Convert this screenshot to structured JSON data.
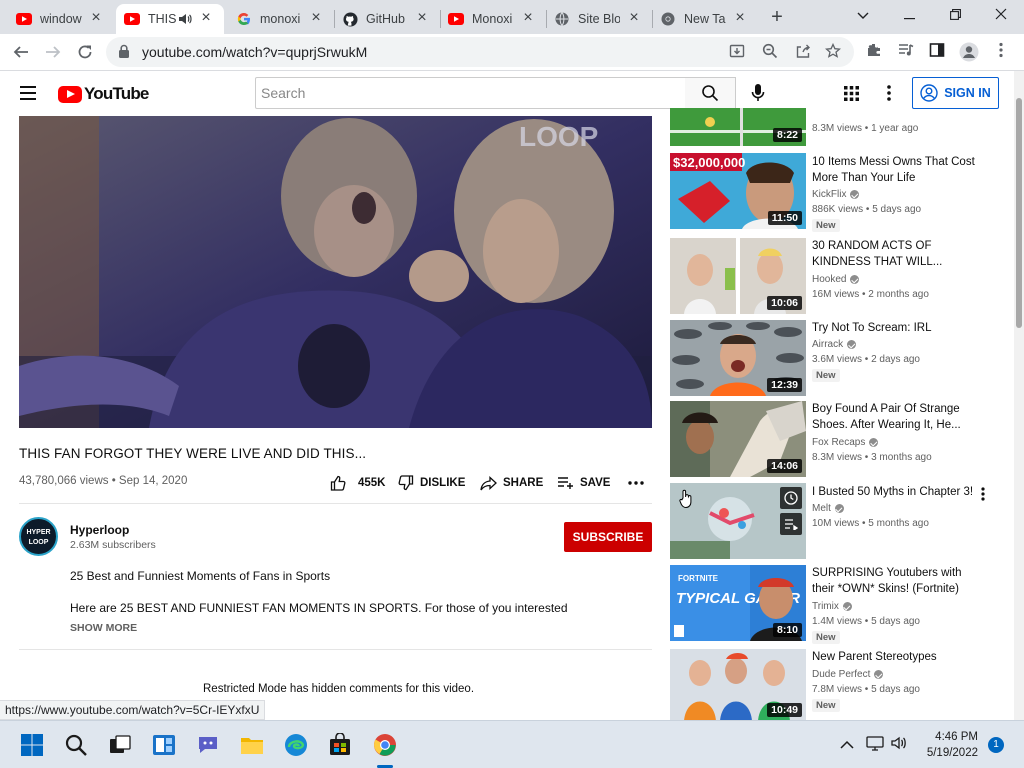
{
  "browser": {
    "tabs": [
      {
        "title": "window",
        "icon": "youtube-favicon"
      },
      {
        "title": "THIS",
        "icon": "youtube-favicon",
        "audio": true
      },
      {
        "title": "monoxi",
        "icon": "google-favicon"
      },
      {
        "title": "GitHub",
        "icon": "github-favicon"
      },
      {
        "title": "Monoxi",
        "icon": "youtube-favicon"
      },
      {
        "title": "Site Blo",
        "icon": "globe-favicon"
      },
      {
        "title": "New Tal",
        "icon": "chrome-favicon"
      }
    ],
    "url": "youtube.com/watch?v=quprjSrwukM"
  },
  "header": {
    "logo_text": "YouTube",
    "search_placeholder": "Search",
    "signin_label": "SIGN IN"
  },
  "video": {
    "watermark": "LOOP",
    "title": "THIS FAN FORGOT THEY WERE LIVE AND DID THIS...",
    "meta": "43,780,066 views • Sep 14, 2020",
    "likes": "455K",
    "dislike_label": "DISLIKE",
    "share_label": "SHARE",
    "save_label": "SAVE"
  },
  "channel": {
    "avatar_text": "HYPER LOOP",
    "name": "Hyperloop",
    "subs": "2.63M subscribers",
    "subscribe_label": "SUBSCRIBE"
  },
  "description": {
    "line1": "25 Best and Funniest Moments of Fans in Sports",
    "line2": "Here are 25 BEST AND FUNNIEST FAN MOMENTS IN SPORTS. For those of you interested on how I",
    "show_more": "SHOW MORE"
  },
  "comments_notice": "Restricted Mode has hidden comments for this video.",
  "status_url": "https://www.youtube.com/watch?v=5Cr-IEYxfxU",
  "recommendations": [
    {
      "title": "",
      "channel": "",
      "views": "8.3M views • 1 year ago",
      "duration": "8:22",
      "is_new": false
    },
    {
      "title": "10 Items Messi Owns That Cost More Than Your Life",
      "channel": "KickFlix",
      "views": "886K views • 5 days ago",
      "duration": "11:50",
      "is_new": true,
      "overlay_text": "$32,000,000"
    },
    {
      "title": "30 RANDOM ACTS OF KINDNESS THAT WILL...",
      "channel": "Hooked",
      "views": "16M views • 2 months ago",
      "duration": "10:06",
      "is_new": false
    },
    {
      "title": "Try Not To Scream: IRL",
      "channel": "Airrack",
      "views": "3.6M views • 2 days ago",
      "duration": "12:39",
      "is_new": true
    },
    {
      "title": "Boy Found A Pair Of Strange Shoes. After Wearing It, He...",
      "channel": "Fox Recaps",
      "views": "8.3M views • 3 months ago",
      "duration": "14:06",
      "is_new": false
    },
    {
      "title": "I Busted 50 Myths in Chapter 3!",
      "channel": "Melt",
      "views": "10M views • 5 months ago",
      "duration": "",
      "is_new": false
    },
    {
      "title": "SURPRISING Youtubers with their *OWN* Skins! (Fortnite)",
      "channel": "Trimix",
      "views": "1.4M views • 5 days ago",
      "duration": "8:10",
      "is_new": true,
      "overlay_text": "TYPICAL GAMER"
    },
    {
      "title": "New Parent Stereotypes",
      "channel": "Dude Perfect",
      "views": "7.8M views • 5 days ago",
      "duration": "10:49",
      "is_new": true
    }
  ],
  "taskbar": {
    "time": "4:46 PM",
    "date": "5/19/2022",
    "notifications": "1"
  }
}
